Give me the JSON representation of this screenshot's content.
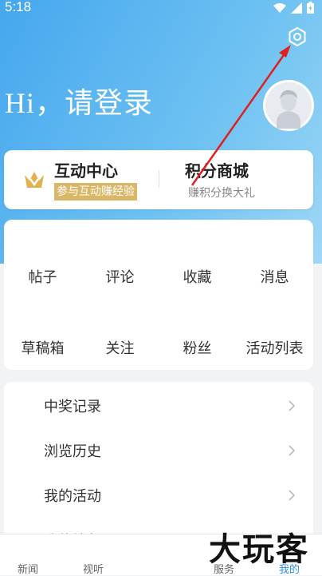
{
  "status": {
    "time": "5:18"
  },
  "header": {
    "greeting": "Hi，请登录"
  },
  "points_card": {
    "interact_title": "互动中心",
    "interact_sub": "参与互动赚经验",
    "shop_title": "积分商城",
    "shop_sub": "赚积分换大礼"
  },
  "grid": {
    "items": [
      "帖子",
      "评论",
      "收藏",
      "消息",
      "草稿箱",
      "关注",
      "粉丝",
      "活动列表"
    ]
  },
  "list": {
    "items": [
      "中奖记录",
      "浏览历史",
      "我的活动",
      "我的钱包"
    ]
  },
  "tabbar": {
    "items": [
      "新闻",
      "视听",
      "服务",
      "我的"
    ],
    "active": "我的"
  },
  "watermark": "大玩客",
  "colors": {
    "accent": "#2d8fe0",
    "gold": "#d9b767",
    "annotation": "#e02020"
  }
}
